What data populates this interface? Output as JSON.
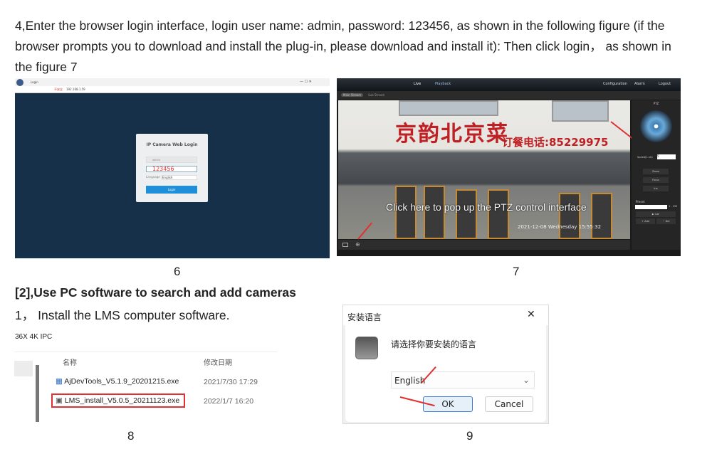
{
  "intro": {
    "line1": "4,Enter the browser login interface, login user name: admin, password: 123456, as shown in the following figure (if the",
    "line2": "browser prompts you to download and install the plug-in, please download and install it): Then click login， as shown in",
    "line3": "the figure 7"
  },
  "fig6": {
    "tab": "Login",
    "address": "192.168.1.59",
    "security": "不安全",
    "login_title": "IP Camera Web Login",
    "username": "admin",
    "password": "123456",
    "language_label": "Language",
    "language": "English",
    "login_button": "Login",
    "caption": "6"
  },
  "fig7": {
    "nav": [
      "Live",
      "Playback",
      "Configuration",
      "Alarm",
      "Logout"
    ],
    "streams": [
      "Main Stream",
      "Sub Stream"
    ],
    "sign": "京韵北京菜",
    "phone": "订餐电话:85229975",
    "overlay": "Click here to pop up the PTZ control interface",
    "osd_time": "2021-12-08 Wednesday 15:55:32",
    "ptz_title": "PTZ",
    "speed_label": "Speed(1-10)",
    "speed": "5",
    "buttons": [
      "Zoom",
      "Focus",
      "Iris"
    ],
    "preset_label": "Preset",
    "preset_range": "1 - 255",
    "call": "▶ Call",
    "add": "+ Add",
    "del": "− Del",
    "caption": "7"
  },
  "section": {
    "heading": "[2],Use PC software to search and add cameras",
    "step": "1， Install the LMS computer software."
  },
  "fig8": {
    "path": "36X 4K IPC",
    "col_name": "名称",
    "col_date": "修改日期",
    "files": [
      {
        "name": "AjDevTools_V5.1.9_20201215.exe",
        "date": "2021/7/30 17:29"
      },
      {
        "name": "LMS_install_V5.0.5_20211123.exe",
        "date": "2022/1/7 16:20"
      }
    ],
    "caption": "8"
  },
  "fig9": {
    "title": "安装语言",
    "prompt": "请选择你要安装的语言",
    "language": "English",
    "ok": "OK",
    "cancel": "Cancel",
    "caption": "9"
  },
  "colors": {
    "highlight": "#e0302f",
    "login_bg": "#17304a",
    "login_button": "#1e8fd8"
  }
}
